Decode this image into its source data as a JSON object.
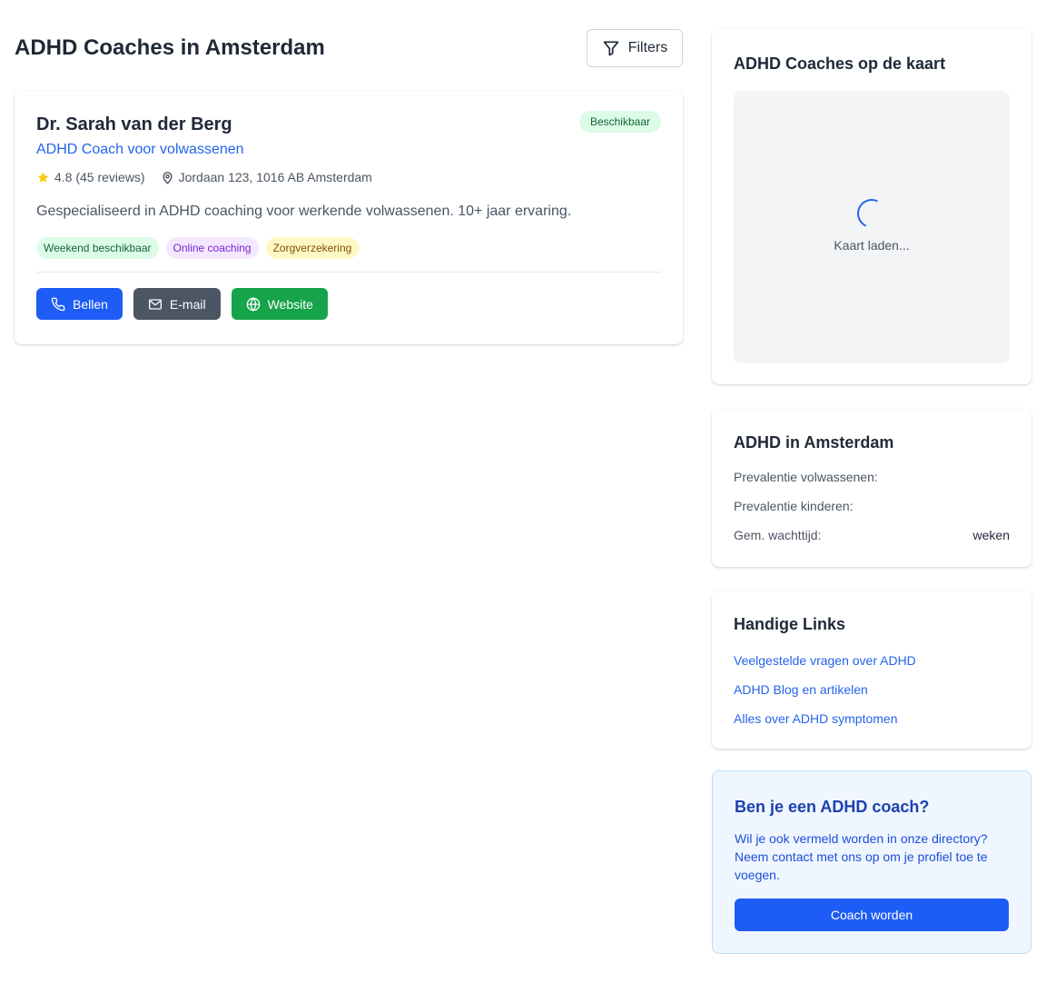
{
  "header": {
    "title": "ADHD Coaches in Amsterdam",
    "filters_label": "Filters"
  },
  "coach": {
    "name": "Dr. Sarah van der Berg",
    "title": "ADHD Coach voor volwassenen",
    "badge": "Beschikbaar",
    "rating": "4.8 (45 reviews)",
    "address": "Jordaan 123, 1016 AB Amsterdam",
    "description": "Gespecialiseerd in ADHD coaching voor werkende volwassenen. 10+ jaar ervaring.",
    "tags": [
      "Weekend beschikbaar",
      "Online coaching",
      "Zorgverzekering"
    ],
    "actions": {
      "call": "Bellen",
      "email": "E-mail",
      "website": "Website"
    }
  },
  "map": {
    "title": "ADHD Coaches op de kaart",
    "loading": "Kaart laden..."
  },
  "stats": {
    "title": "ADHD in Amsterdam",
    "rows": [
      {
        "label": "Prevalentie volwassenen:",
        "value": ""
      },
      {
        "label": "Prevalentie kinderen:",
        "value": ""
      },
      {
        "label": "Gem. wachttijd:",
        "value": "weken"
      }
    ]
  },
  "links": {
    "title": "Handige Links",
    "items": [
      "Veelgestelde vragen over ADHD",
      "ADHD Blog en artikelen",
      "Alles over ADHD symptomen"
    ]
  },
  "cta": {
    "title": "Ben je een ADHD coach?",
    "text": "Wil je ook vermeld worden in onze directory? Neem contact met ons op om je profiel toe te voegen.",
    "button": "Coach worden"
  },
  "colors": {
    "primary": "#1d5cf5",
    "link": "#2563eb",
    "success": "#16a34a",
    "neutral_button": "#4b5563",
    "star": "#facc15"
  },
  "icons": [
    "filter-icon",
    "star-icon",
    "map-pin-icon",
    "phone-icon",
    "mail-icon",
    "globe-icon",
    "loading-spinner"
  ]
}
